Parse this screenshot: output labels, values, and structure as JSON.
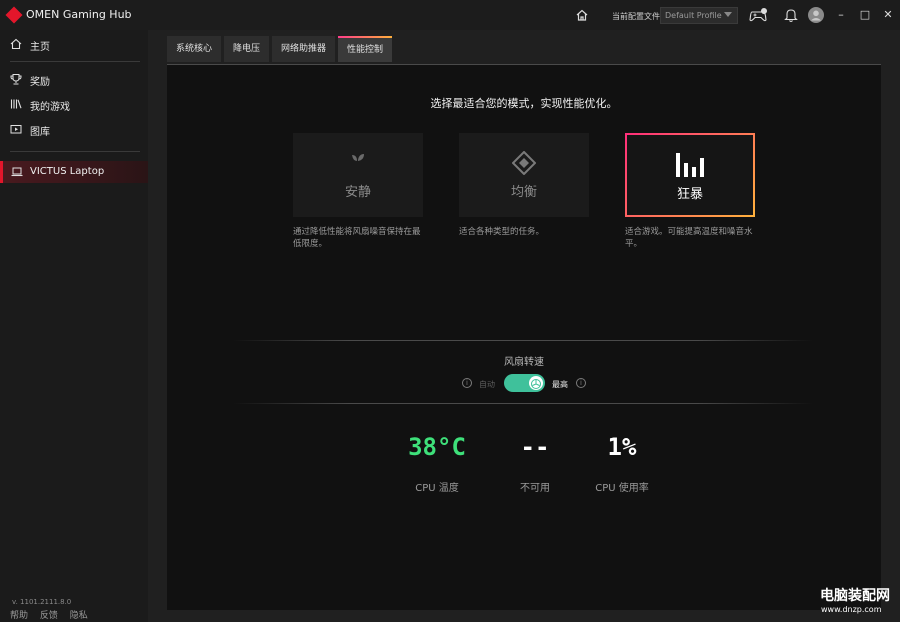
{
  "titlebar": {
    "app_title": "OMEN Gaming Hub",
    "profile_label": "当前配置文件",
    "profile_value": "Default Profile",
    "minimize": "–",
    "maximize": "□",
    "close": "✕"
  },
  "sidebar": {
    "items": [
      {
        "label": "主页",
        "icon": "home-icon"
      },
      {
        "label": "奖励",
        "icon": "trophy-icon"
      },
      {
        "label": "我的游戏",
        "icon": "library-icon"
      },
      {
        "label": "图库",
        "icon": "gallery-icon"
      }
    ],
    "device": "VICTUS Laptop",
    "version": "v. 1101.2111.8.0",
    "footer_links": [
      "帮助",
      "反馈",
      "隐私"
    ]
  },
  "tabs": [
    {
      "label": "系统核心",
      "active": false
    },
    {
      "label": "降电压",
      "active": false
    },
    {
      "label": "网络助推器",
      "active": false
    },
    {
      "label": "性能控制",
      "active": true
    }
  ],
  "performance": {
    "headline": "选择最适合您的模式，实现性能优化。",
    "modes": [
      {
        "label": "安静",
        "icon": "leaf-icon",
        "desc": "通过降低性能将风扇噪音保持在最低限度。",
        "selected": false
      },
      {
        "label": "均衡",
        "icon": "diamond-icon",
        "desc": "适合各种类型的任务。",
        "selected": false
      },
      {
        "label": "狂暴",
        "icon": "bars-icon",
        "desc": "适合游戏。可能提高温度和噪音水平。",
        "selected": true
      }
    ]
  },
  "fan": {
    "title": "风扇转速",
    "auto_label": "自动",
    "max_label": "最高",
    "toggle_on": true,
    "toggle_color": "#3fc19b"
  },
  "metrics": [
    {
      "value": "38°C",
      "label": "CPU 温度",
      "color": "#3ee07a"
    },
    {
      "value": "--",
      "label": "不可用",
      "color": "#ffffff"
    },
    {
      "value": "1%",
      "label": "CPU 使用率",
      "color": "#ffffff"
    }
  ],
  "watermark": {
    "title": "电脑装配网",
    "url": "www.dnzp.com"
  },
  "colors": {
    "brand_red": "#e3162b",
    "accent_gradient_start": "#ff2e7a",
    "accent_gradient_end": "#ffb13c"
  }
}
